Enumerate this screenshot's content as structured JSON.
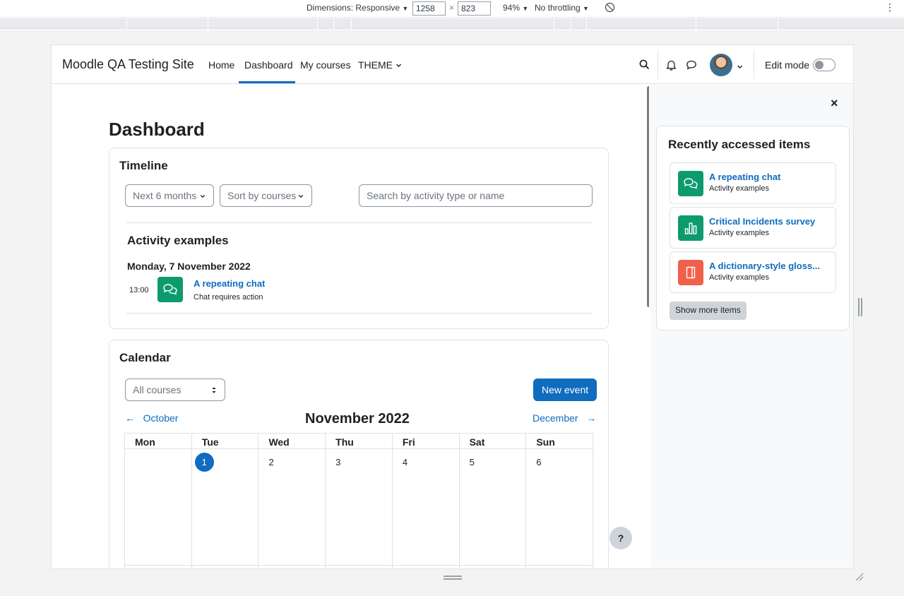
{
  "devtools": {
    "dimensions_label": "Dimensions: Responsive",
    "width": "1258",
    "times": "×",
    "height": "823",
    "zoom": "94%",
    "throttle": "No throttling",
    "caret": "▼",
    "menu": "⋮"
  },
  "navbar": {
    "brand": "Moodle QA Testing Site",
    "links": [
      "Home",
      "Dashboard",
      "My courses",
      "THEME"
    ],
    "active_link": "Dashboard",
    "edit_mode_label": "Edit mode",
    "edit_mode_on": false
  },
  "page": {
    "title": "Dashboard"
  },
  "timeline": {
    "title": "Timeline",
    "filter_label": "Next 6 months",
    "sort_label": "Sort by courses",
    "search_placeholder": "Search by activity type or name",
    "course_heading": "Activity examples",
    "date_heading": "Monday, 7 November 2022",
    "event": {
      "time": "13:00",
      "name": "A repeating chat",
      "detail": "Chat requires action"
    }
  },
  "calendar": {
    "title": "Calendar",
    "course_select": "All courses",
    "new_event_label": "New event",
    "prev_month": "October",
    "next_month": "December",
    "prev_arrow": "←",
    "next_arrow": "→",
    "month_title": "November 2022",
    "weekdays": [
      "Mon",
      "Tue",
      "Wed",
      "Thu",
      "Fri",
      "Sat",
      "Sun"
    ],
    "week1": [
      "",
      "1",
      "2",
      "3",
      "4",
      "5",
      "6"
    ],
    "today": "1"
  },
  "drawer": {
    "close": "×",
    "block_title": "Recently accessed items",
    "items": [
      {
        "name": "A repeating chat",
        "course": "Activity examples",
        "icon": "chat-icon",
        "color": "#0d9b6e"
      },
      {
        "name": "Critical Incidents survey",
        "course": "Activity examples",
        "icon": "survey-icon",
        "color": "#0d9b6e"
      },
      {
        "name": "A dictionary-style gloss...",
        "course": "Activity examples",
        "icon": "glossary-icon",
        "color": "#f1604b"
      }
    ],
    "show_more": "Show more items"
  },
  "help": "?",
  "colors": {
    "primary": "#0f6cbf",
    "collaboration": "#0d9b6e",
    "content": "#f1604b"
  }
}
